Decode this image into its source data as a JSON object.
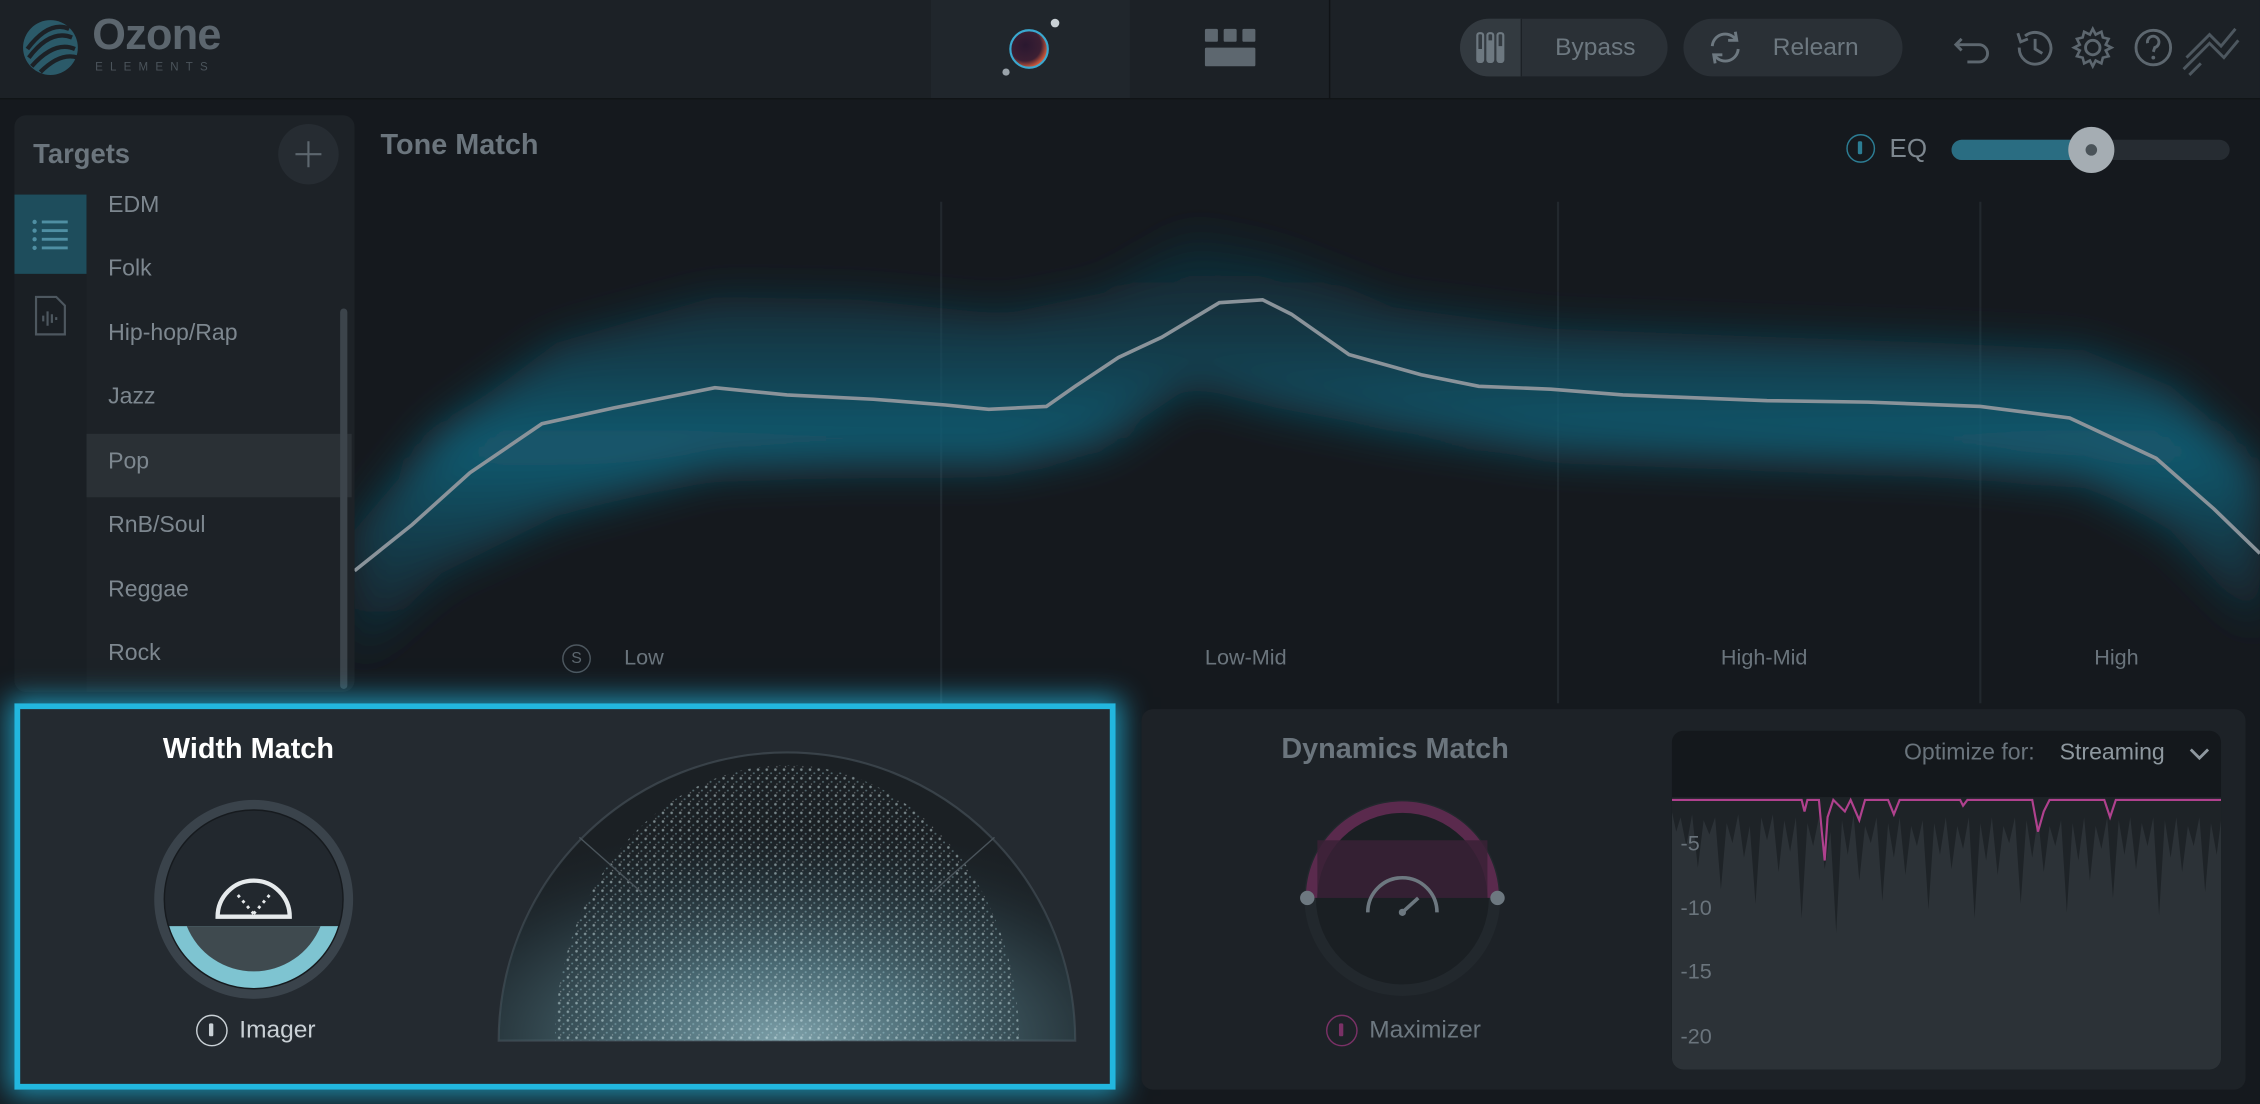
{
  "app": {
    "logo_text": "Ozone",
    "logo_sub": "ELEMENTS"
  },
  "header": {
    "bypass_label": "Bypass",
    "relearn_label": "Relearn",
    "icons": [
      "assistant-orb-icon",
      "modules-grid-icon",
      "meters-icon",
      "relearn-refresh-icon",
      "undo-icon",
      "history-icon",
      "settings-gear-icon",
      "help-icon",
      "izotope-logo-icon"
    ]
  },
  "targets": {
    "title": "Targets",
    "items": [
      "EDM",
      "Folk",
      "Hip-hop/Rap",
      "Jazz",
      "Pop",
      "RnB/Soul",
      "Reggae",
      "Rock"
    ],
    "selected": "Pop"
  },
  "tone_match": {
    "title": "Tone Match",
    "eq_label": "EQ",
    "eq_amount": 0.5,
    "solo_label": "S",
    "bands": [
      "Low",
      "Low-Mid",
      "High-Mid",
      "High"
    ]
  },
  "width_match": {
    "title": "Width Match",
    "module_label": "Imager",
    "amount": 0.35
  },
  "dynamics_match": {
    "title": "Dynamics Match",
    "module_label": "Maximizer",
    "optimize_label": "Optimize for:",
    "optimize_value": "Streaming",
    "db_ticks": [
      "-5",
      "-10",
      "-15",
      "-20"
    ]
  },
  "colors": {
    "accent": "#22b7df",
    "teal_fill": "#7ec4d1",
    "magenta": "#b0418e"
  }
}
